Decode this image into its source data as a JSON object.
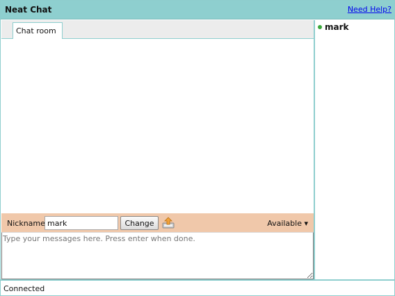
{
  "header": {
    "title": "Neat Chat",
    "help_link": "Need Help?"
  },
  "tabs": [
    {
      "label": "Chat room",
      "active": true
    }
  ],
  "toolbar": {
    "nickname_label": "Nickname:",
    "nickname_value": "mark",
    "change_label": "Change",
    "upload_icon": "upload-icon",
    "status_label": "Available ▾"
  },
  "compose": {
    "placeholder": "Type your messages here. Press enter when done."
  },
  "users": [
    {
      "name": "mark",
      "status_color": "#3aa83a"
    }
  ],
  "statusbar": {
    "text": "Connected"
  },
  "colors": {
    "accent": "#8ecfcf",
    "toolbar_bg": "#f0c8aa",
    "online": "#3aa83a"
  }
}
